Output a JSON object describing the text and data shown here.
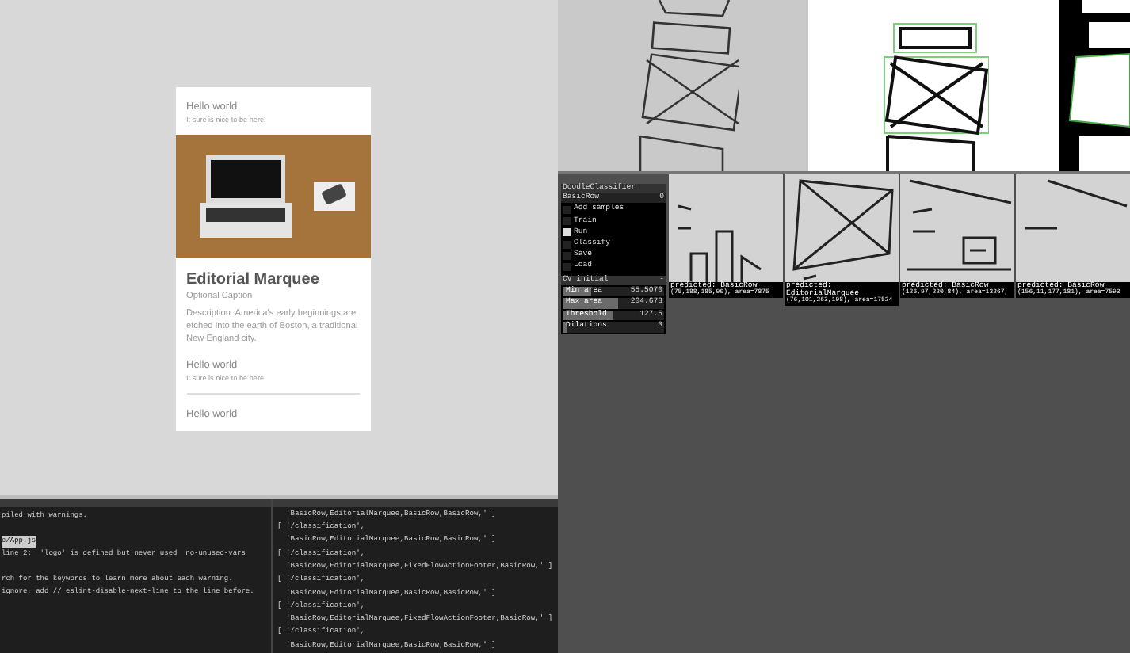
{
  "preview_card": {
    "rows_top": [
      {
        "title": "Hello world",
        "subtitle": "It sure is nice to be here!"
      }
    ],
    "marquee": {
      "title": "Editorial Marquee",
      "caption": "Optional Caption",
      "description": "Description: America's early beginnings are etched into the earth of Boston, a traditional New England city."
    },
    "rows_bottom": [
      {
        "title": "Hello world",
        "subtitle": "It sure is nice to be here!"
      },
      {
        "title": "Hello world"
      }
    ]
  },
  "terminal_left": {
    "lines": [
      {
        "text": "piled with warnings.",
        "kind": "plain"
      },
      {
        "kind": "blank"
      },
      {
        "text": "c/App.js",
        "kind": "file"
      },
      {
        "text": "line 2:  'logo' is defined but never used  no-unused-vars",
        "kind": "plain"
      },
      {
        "kind": "blank"
      },
      {
        "text": "rch for the keywords to learn more about each warning.",
        "kind": "plain"
      },
      {
        "text": "ignore, add // eslint-disable-next-line to the line before.",
        "kind": "plain"
      }
    ]
  },
  "terminal_right": {
    "lines": [
      "  'BasicRow,EditorialMarquee,BasicRow,BasicRow,' ]",
      "[ '/classification',",
      "  'BasicRow,EditorialMarquee,BasicRow,BasicRow,' ]",
      "[ '/classification',",
      "  'BasicRow,EditorialMarquee,FixedFlowActionFooter,BasicRow,' ]",
      "[ '/classification',",
      "  'BasicRow,EditorialMarquee,BasicRow,BasicRow,' ]",
      "[ '/classification',",
      "  'BasicRow,EditorialMarquee,FixedFlowActionFooter,BasicRow,' ]",
      "[ '/classification',",
      "  'BasicRow,EditorialMarquee,BasicRow,BasicRow,' ]"
    ]
  },
  "classifier_panel": {
    "title": "DoodleClassifier",
    "class_label": "BasicRow",
    "class_value": "0",
    "toggles": [
      {
        "label": "Add samples",
        "checked": false
      },
      {
        "label": "Train",
        "checked": false
      },
      {
        "label": "Run",
        "checked": true
      },
      {
        "label": "Classify",
        "checked": false
      },
      {
        "label": "Save",
        "checked": false
      },
      {
        "label": "Load",
        "checked": false
      }
    ],
    "section": "CV initial",
    "section_toggle": "-",
    "sliders": [
      {
        "label": "Min area",
        "value": "55.5070",
        "level": 0.28
      },
      {
        "label": "Max area",
        "value": "204.673",
        "level": 0.55
      },
      {
        "label": "Threshold",
        "value": "127.5",
        "level": 0.5
      },
      {
        "label": "Dilations",
        "value": "3",
        "level": 0.05
      }
    ]
  },
  "detections": [
    {
      "label": "predicted: BasicRow",
      "coords": "(75,188,185,90), area=7875"
    },
    {
      "label": "predicted: EditorialMarquee",
      "coords": "(76,101,263,198), area=17524"
    },
    {
      "label": "predicted: BasicRow",
      "coords": "(126,97,220,84), area=13267,"
    },
    {
      "label": "predicted: BasicRow",
      "coords": "(156,11,177,181), area=7593"
    }
  ]
}
